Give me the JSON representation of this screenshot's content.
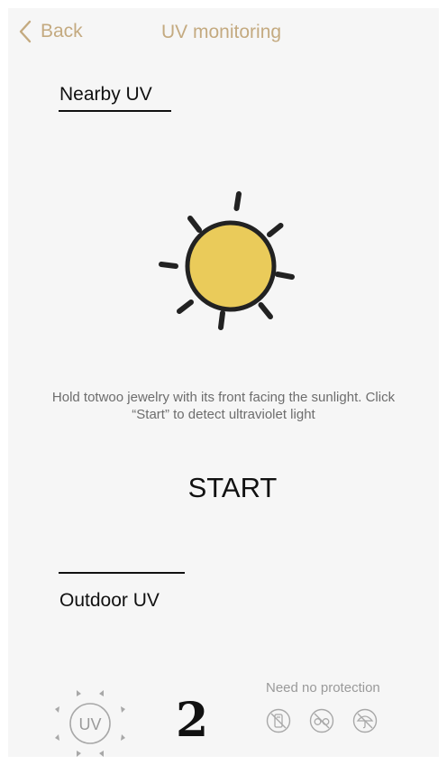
{
  "nav": {
    "back_label": "Back",
    "title": "UV monitoring"
  },
  "nearby": {
    "title": "Nearby UV",
    "instruction": "Hold totwoo jewelry with its front facing the sunlight. Click “Start” to detect ultraviolet light",
    "start_label": "START",
    "sun_icon": "sun-icon"
  },
  "outdoor": {
    "title": "Outdoor UV",
    "uv_badge_text": "UV",
    "uv_index": "2",
    "protection_label": "Need no protection",
    "protection_icons": [
      "no-sunscreen-icon",
      "no-sunglasses-icon",
      "no-umbrella-icon"
    ]
  },
  "colors": {
    "accent": "#c4aa80",
    "sun_fill": "#eacb5a",
    "text": "#111111",
    "muted": "#6d6d6d",
    "background": "#f6f6f6"
  }
}
